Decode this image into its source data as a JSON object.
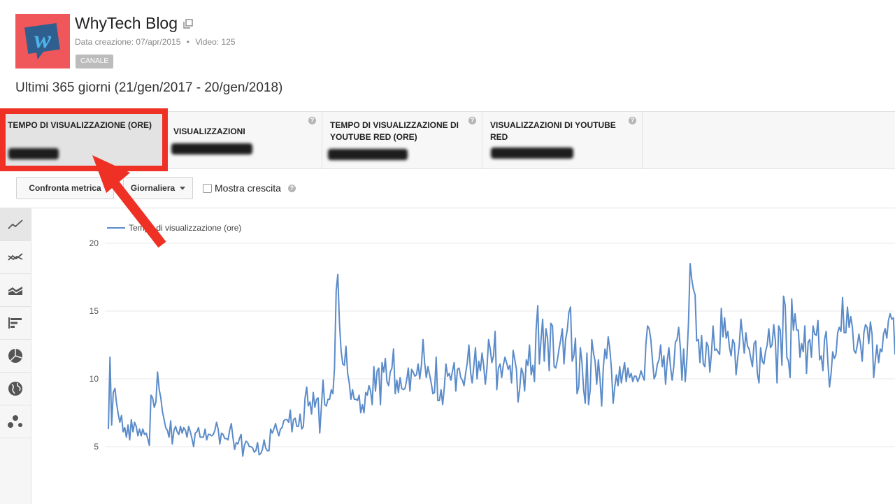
{
  "channel": {
    "logo_letter": "w",
    "name": "WhyTech Blog",
    "meta_created": "Data creazione: 07/apr/2015",
    "meta_separator": "•",
    "meta_videos": "Video: 125",
    "badge": "CANALE"
  },
  "date_range": "Ultimi 365 giorni (21/gen/2017 - 20/gen/2018)",
  "metrics": [
    {
      "label": "TEMPO DI VISUALIZZAZIONE (ORE)",
      "selected": true
    },
    {
      "label": "VISUALIZZAZIONI",
      "selected": false
    },
    {
      "label": "TEMPO DI VISUALIZZAZIONE DI YOUTUBE RED (ORE)",
      "selected": false
    },
    {
      "label": "VISUALIZZAZIONI DI YOUTUBE RED",
      "selected": false
    }
  ],
  "help_glyph": "?",
  "controls": {
    "compare_label": "Confronta metrica",
    "granularity_label": "Giornaliera",
    "growth_label": "Mostra crescita"
  },
  "sidebar_icons": [
    "line-chart-icon",
    "multi-line-chart-icon",
    "stacked-area-chart-icon",
    "bar-chart-icon",
    "pie-chart-icon",
    "globe-map-icon",
    "bubble-chart-icon"
  ],
  "colors": {
    "accent_red": "#ee3124",
    "series_blue": "#5b8bc9",
    "logo_bg": "#f0575a",
    "logo_square": "#2f5f8f"
  },
  "chart_data": {
    "type": "line",
    "series": [
      {
        "name": "Tempo di visualizzazione (ore)",
        "values": [
          6.3,
          11.6,
          6.6,
          9.0,
          9.3,
          8.2,
          7.4,
          6.8,
          7.3,
          6.1,
          6.4,
          5.7,
          6.6,
          5.5,
          7.0,
          6.1,
          6.8,
          6.5,
          5.8,
          6.3,
          5.8,
          6.3,
          5.9,
          6.0,
          5.6,
          5.1,
          8.8,
          8.6,
          7.9,
          8.3,
          10.5,
          9.2,
          8.6,
          7.6,
          7.0,
          6.4,
          6.2,
          5.7,
          6.9,
          5.2,
          6.2,
          6.5,
          6.1,
          5.9,
          6.5,
          6.0,
          6.4,
          6.2,
          5.7,
          6.5,
          6.1,
          5.6,
          5.0,
          6.0,
          6.1,
          6.4,
          5.7,
          5.7,
          5.7,
          6.3,
          5.5,
          5.9,
          5.9,
          5.8,
          5.9,
          6.2,
          6.8,
          6.3,
          5.2,
          6.0,
          5.9,
          5.6,
          5.6,
          5.5,
          6.2,
          6.7,
          5.7,
          4.8,
          5.3,
          5.2,
          5.6,
          5.9,
          4.3,
          5.1,
          5.4,
          5.3,
          5.0,
          5.0,
          4.9,
          4.6,
          4.7,
          5.3,
          4.4,
          4.5,
          4.8,
          5.5,
          4.9,
          4.7,
          4.7,
          6.3,
          6.0,
          6.3,
          6.7,
          6.2,
          5.8,
          6.3,
          6.4,
          6.9,
          7.0,
          7.0,
          6.8,
          7.7,
          6.1,
          7.0,
          7.1,
          6.5,
          6.5,
          7.4,
          6.3,
          6.5,
          8.6,
          9.4,
          8.0,
          8.3,
          7.4,
          9.0,
          7.9,
          8.5,
          8.6,
          6.0,
          8.0,
          9.9,
          8.1,
          8.0,
          8.5,
          8.5,
          9.2,
          8.9,
          10.8,
          16.5,
          17.7,
          14.1,
          12.1,
          11.1,
          11.0,
          12.4,
          10.4,
          9.7,
          8.5,
          9.2,
          8.5,
          8.5,
          8.4,
          8.8,
          7.5,
          8.1,
          7.5,
          9.0,
          8.8,
          9.5,
          9.1,
          8.1,
          10.9,
          9.1,
          10.6,
          10.8,
          8.1,
          11.2,
          10.5,
          11.5,
          9.8,
          9.5,
          10.5,
          10.8,
          12.2,
          8.9,
          9.9,
          9.0,
          10.1,
          9.3,
          9.2,
          9.3,
          9.9,
          10.8,
          9.1,
          10.7,
          10.5,
          10.2,
          10.3,
          11.1,
          10.0,
          11.0,
          12.9,
          11.2,
          10.1,
          10.9,
          10.3,
          9.7,
          8.9,
          9.0,
          11.6,
          8.4,
          8.4,
          9.2,
          8.1,
          9.4,
          11.1,
          10.2,
          10.4,
          9.9,
          10.6,
          11.2,
          9.1,
          10.7,
          10.8,
          10.1,
          9.9,
          9.5,
          10.4,
          11.2,
          12.5,
          10.5,
          9.7,
          11.0,
          12.3,
          10.0,
          11.3,
          10.6,
          11.9,
          11.0,
          9.6,
          10.8,
          12.9,
          12.2,
          11.2,
          11.7,
          13.5,
          9.2,
          10.8,
          11.1,
          10.1,
          11.0,
          11.6,
          11.2,
          10.7,
          11.0,
          9.7,
          12.1,
          11.4,
          10.7,
          8.3,
          9.3,
          10.8,
          10.4,
          9.1,
          11.4,
          11.0,
          12.5,
          10.3,
          11.0,
          9.8,
          13.6,
          15.4,
          11.1,
          12.9,
          14.4,
          11.3,
          13.7,
          13.0,
          10.6,
          14.1,
          13.9,
          10.9,
          10.8,
          11.4,
          12.2,
          12.9,
          13.7,
          11.1,
          12.9,
          13.6,
          14.9,
          15.3,
          11.3,
          11.7,
          13.0,
          8.9,
          9.4,
          12.3,
          11.2,
          9.2,
          8.2,
          11.9,
          8.1,
          9.2,
          12.9,
          11.9,
          11.3,
          9.6,
          11.4,
          10.0,
          8.0,
          10.8,
          12.2,
          11.5,
          13.1,
          12.2,
          10.7,
          8.2,
          9.4,
          10.3,
          9.5,
          10.9,
          9.7,
          10.5,
          11.2,
          9.8,
          10.8,
          10.1,
          10.4,
          9.8,
          10.2,
          10.2,
          9.8,
          10.1,
          10.6,
          10.2,
          9.9,
          12.6,
          13.9,
          13.7,
          12.9,
          11.4,
          10.0,
          10.3,
          11.1,
          11.4,
          12.5,
          10.9,
          11.7,
          9.6,
          11.3,
          12.3,
          10.9,
          9.9,
          10.9,
          12.7,
          12.9,
          13.8,
          12.3,
          9.9,
          12.2,
          9.8,
          11.4,
          14.2,
          18.5,
          17.3,
          16.6,
          16.2,
          12.8,
          12.9,
          11.2,
          13.2,
          11.1,
          10.9,
          12.7,
          12.4,
          10.5,
          11.9,
          13.9,
          12.1,
          12.2,
          12.0,
          11.8,
          15.2,
          13.1,
          14.5,
          13.0,
          13.5,
          12.3,
          11.7,
          12.9,
          12.6,
          10.3,
          11.5,
          12.5,
          14.4,
          13.2,
          11.9,
          13.4,
          12.4,
          12.2,
          11.5,
          10.9,
          12.6,
          12.8,
          10.4,
          9.7,
          12.3,
          11.3,
          11.1,
          12.0,
          12.5,
          13.7,
          12.3,
          12.5,
          14.0,
          12.8,
          9.7,
          13.9,
          13.6,
          11.0,
          16.1,
          15.4,
          11.6,
          11.3,
          10.1,
          15.9,
          13.6,
          14.8,
          13.6,
          13.6,
          11.6,
          12.6,
          12.0,
          13.9,
          10.4,
          12.7,
          12.9,
          11.6,
          13.9,
          13.3,
          13.2,
          14.3,
          11.4,
          11.7,
          10.6,
          12.9,
          13.5,
          11.3,
          9.4,
          10.4,
          12.0,
          11.5,
          11.8,
          13.4,
          13.8,
          13.5,
          16.0,
          13.4,
          13.4,
          15.3,
          13.8,
          14.6,
          13.8,
          12.1,
          11.9,
          12.5,
          13.3,
          12.5,
          11.3,
          13.4,
          14.0,
          13.8,
          12.6,
          14.2,
          13.3,
          10.1,
          11.4,
          12.5,
          11.2,
          12.2,
          12.0,
          13.3,
          13.7,
          13.0,
          14.3,
          14.8,
          14.4,
          14.5,
          11.8
        ]
      }
    ],
    "yticks": [
      5,
      10,
      15,
      20
    ],
    "ylim": [
      4,
      20
    ],
    "grid": true,
    "legend_position": "top-left"
  }
}
